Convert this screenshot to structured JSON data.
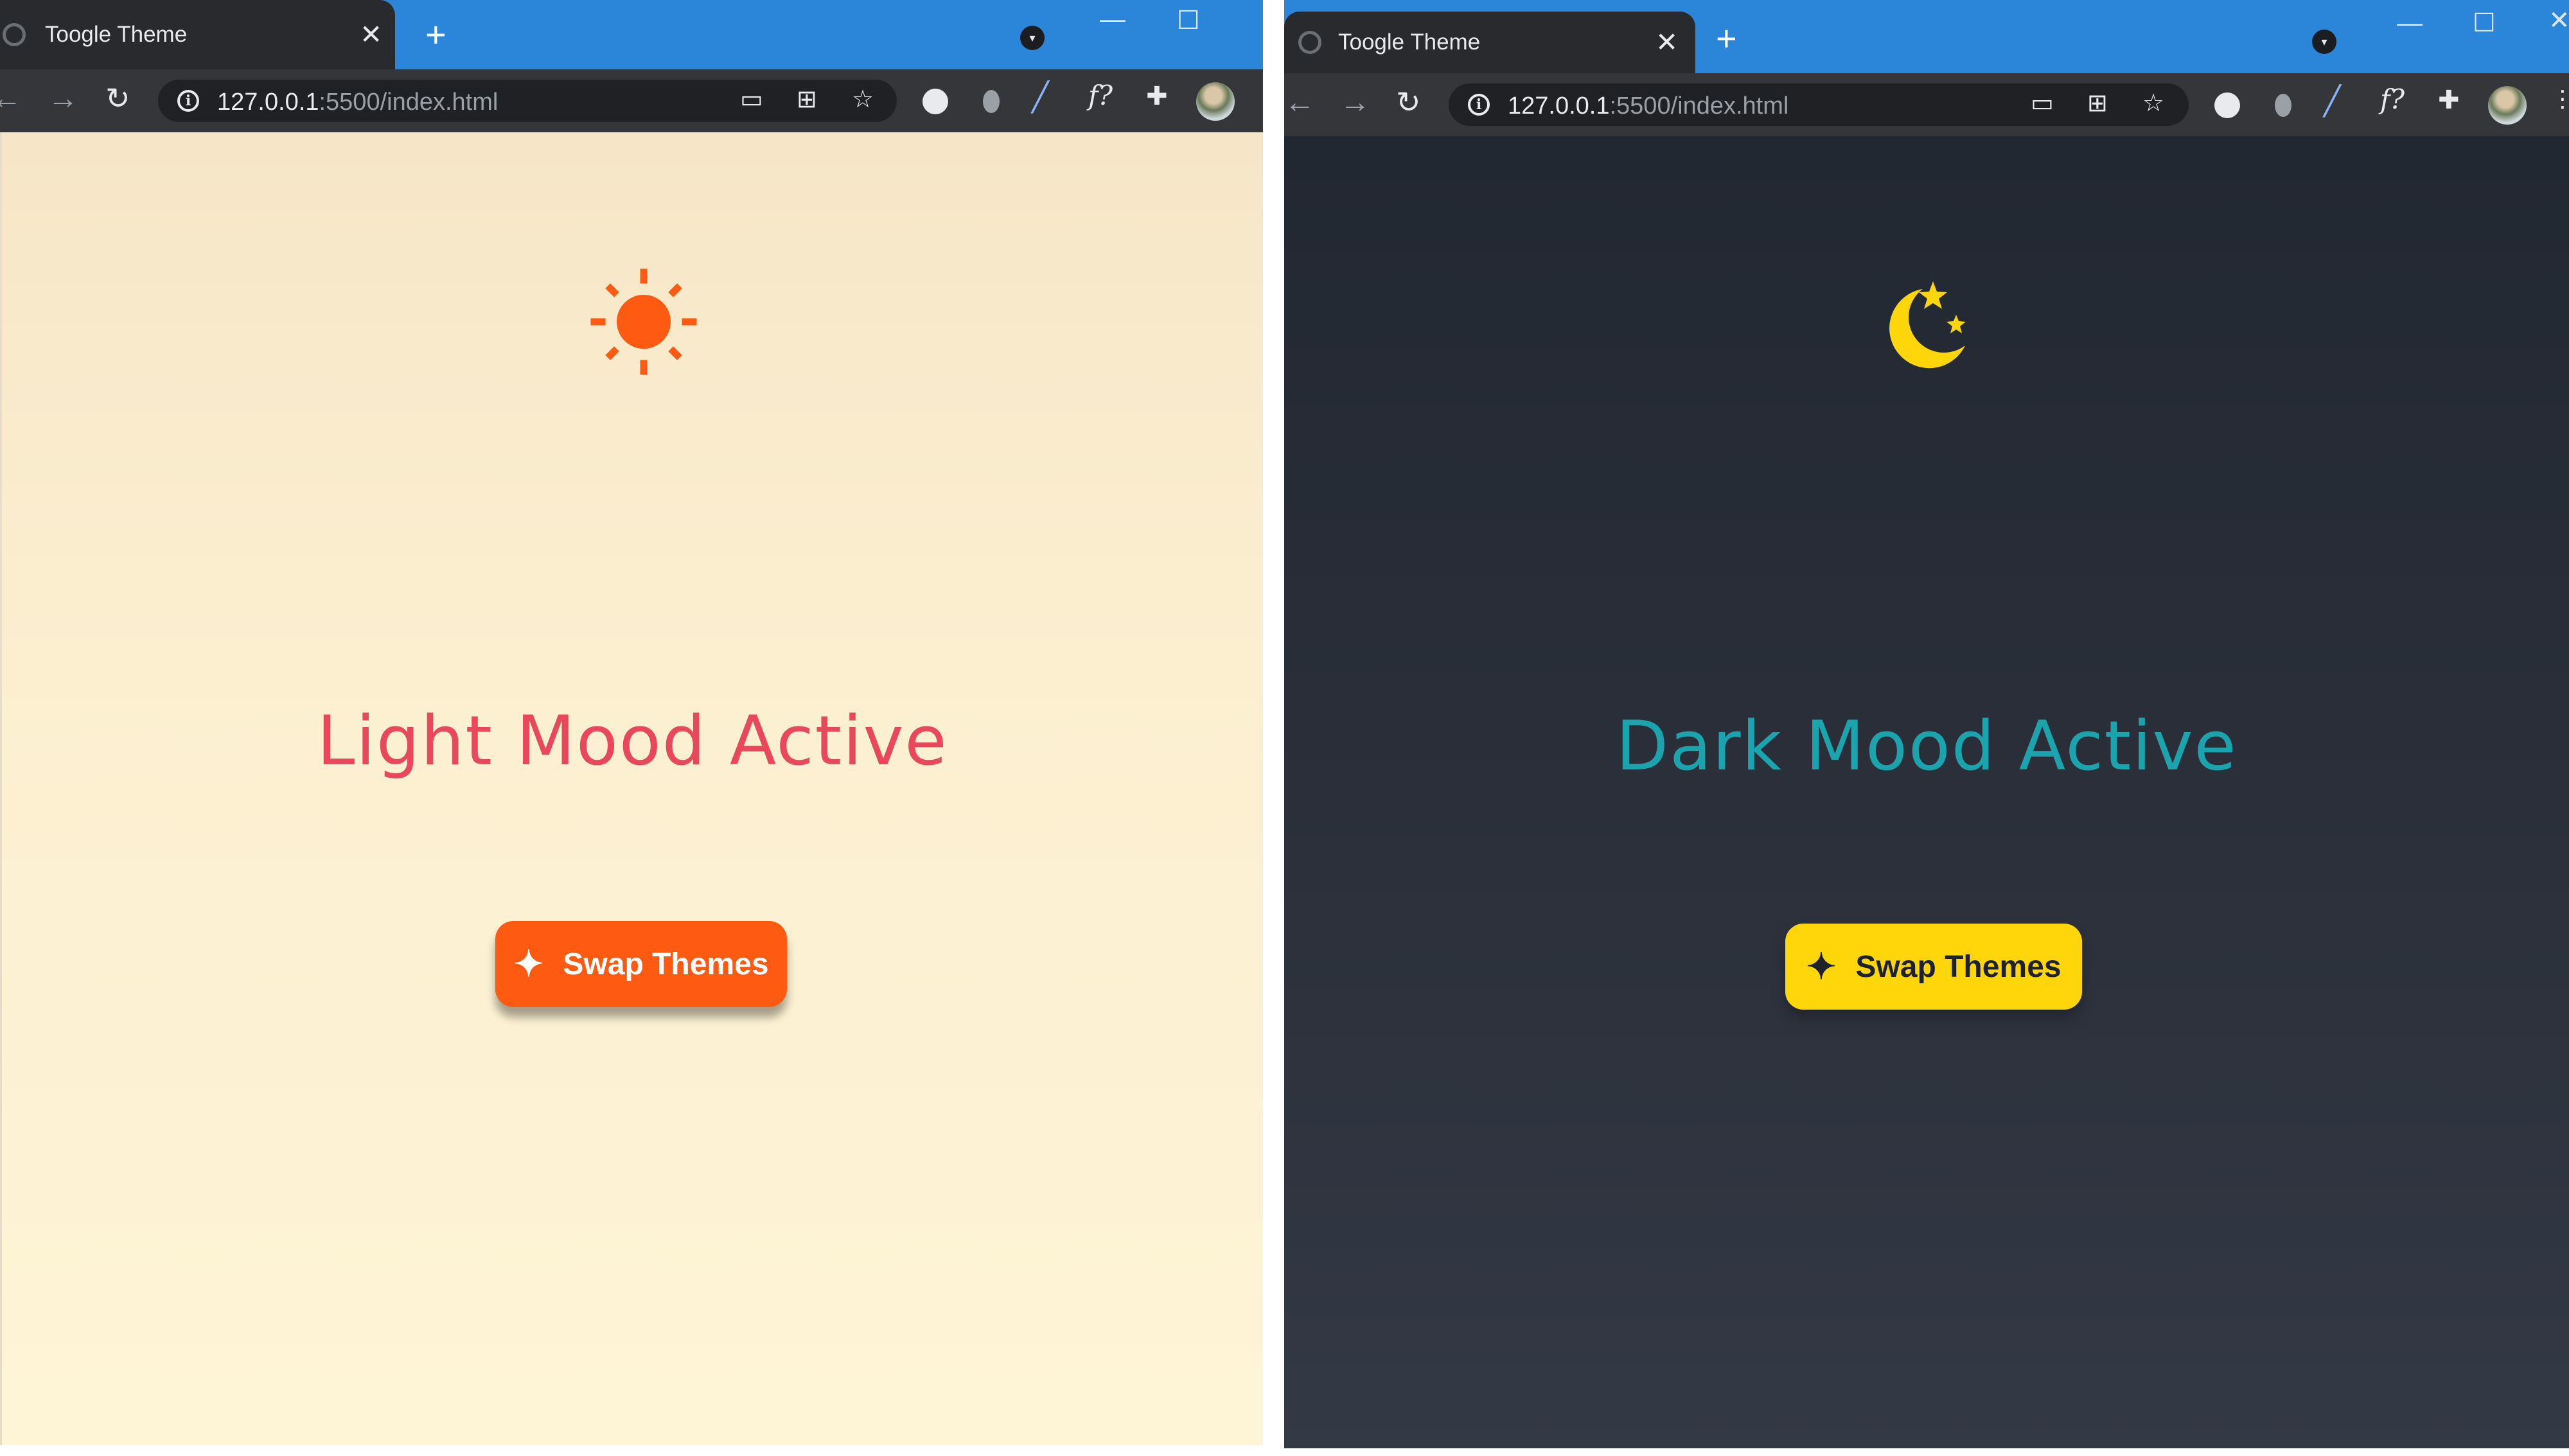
{
  "windows": [
    {
      "tab_title": "Toogle Theme",
      "tab_close": "✕",
      "new_tab": "+",
      "url_host": "127.0.0.1",
      "url_path": ":5500/index.html",
      "heading": "Light Mood Active",
      "button_label": "Swap Themes",
      "theme_icon": "sun-icon",
      "accent_color": "#ff5a12",
      "heading_color": "#e8485a"
    },
    {
      "tab_title": "Toogle Theme",
      "tab_close": "✕",
      "new_tab": "+",
      "url_host": "127.0.0.1",
      "url_path": ":5500/index.html",
      "heading": "Dark Mood Active",
      "button_label": "Swap Themes",
      "theme_icon": "moon-stars-icon",
      "accent_color": "#ffd60a",
      "heading_color": "#1ba3ae"
    }
  ],
  "toolbar_icons": [
    "back-icon",
    "forward-icon",
    "reload-icon",
    "info-icon",
    "cast-icon",
    "qr-icon",
    "star-icon",
    "extension-cookie-icon",
    "extension-drop-icon",
    "extension-pen-icon",
    "fx-icon",
    "puzzle-icon",
    "avatar"
  ],
  "glyphs": {
    "back": "←",
    "forward": "→",
    "reload": "↻",
    "info": "i",
    "star": "☆",
    "puzzle": "✚",
    "fx": "f?",
    "cast": "▭",
    "qr": "⊞",
    "pen": "╱",
    "wand": "✦",
    "search_caret": "▾",
    "minimize": "—",
    "maximize": "☐",
    "close": "✕"
  }
}
